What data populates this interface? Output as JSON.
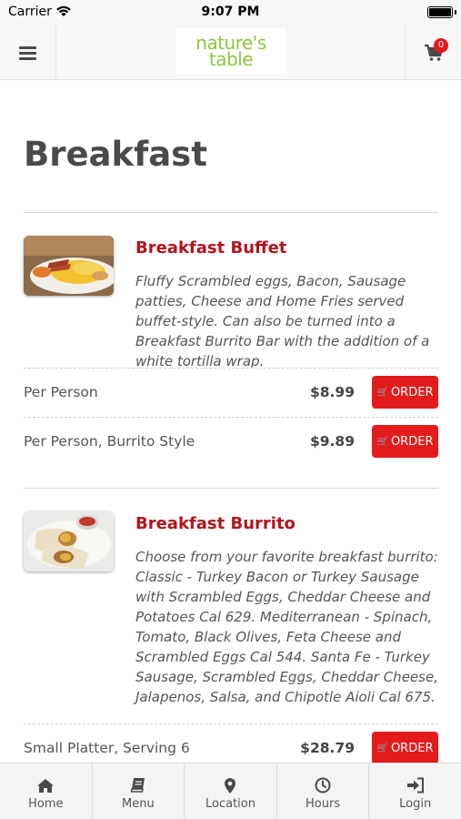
{
  "status_bar": {
    "carrier": "Carrier",
    "time": "9:07 PM"
  },
  "header": {
    "logo_line1": "nature's",
    "logo_line2": "table",
    "cart_count": "0"
  },
  "page": {
    "title": "Breakfast"
  },
  "items": [
    {
      "name": "Breakfast Buffet",
      "description": "Fluffy Scrambled eggs, Bacon, Sausage patties, Cheese and Home Fries served buffet-style. Can also be turned into a Breakfast Burrito Bar with the addition of a white tortilla wrap.",
      "prices": [
        {
          "label": "Per Person",
          "price": "$8.99",
          "button": "ORDER"
        },
        {
          "label": "Per Person, Burrito Style",
          "price": "$9.89",
          "button": "ORDER"
        }
      ]
    },
    {
      "name": "Breakfast Burrito",
      "description": "Choose from your favorite breakfast burrito: Classic - Turkey Bacon or Turkey Sausage with Scrambled Eggs, Cheddar Cheese and Potatoes Cal 629. Mediterranean - Spinach, Tomato, Black Olives, Feta Cheese and Scrambled Eggs Cal 544. Santa Fe - Turkey Sausage, Scrambled Eggs, Cheddar Cheese, Jalapenos, Salsa, and Chipotle Aioli Cal 675.",
      "prices": [
        {
          "label": "Small Platter, Serving 6",
          "price": "$28.79",
          "button": "ORDER"
        }
      ]
    }
  ],
  "bottom_nav": [
    {
      "label": "Home",
      "icon": "home-icon"
    },
    {
      "label": "Menu",
      "icon": "book-icon"
    },
    {
      "label": "Location",
      "icon": "map-pin-icon"
    },
    {
      "label": "Hours",
      "icon": "clock-icon"
    },
    {
      "label": "Login",
      "icon": "sign-in-icon"
    }
  ],
  "colors": {
    "accent": "#e31b1b",
    "item_title": "#b3141c",
    "logo_green": "#8cc63f"
  }
}
